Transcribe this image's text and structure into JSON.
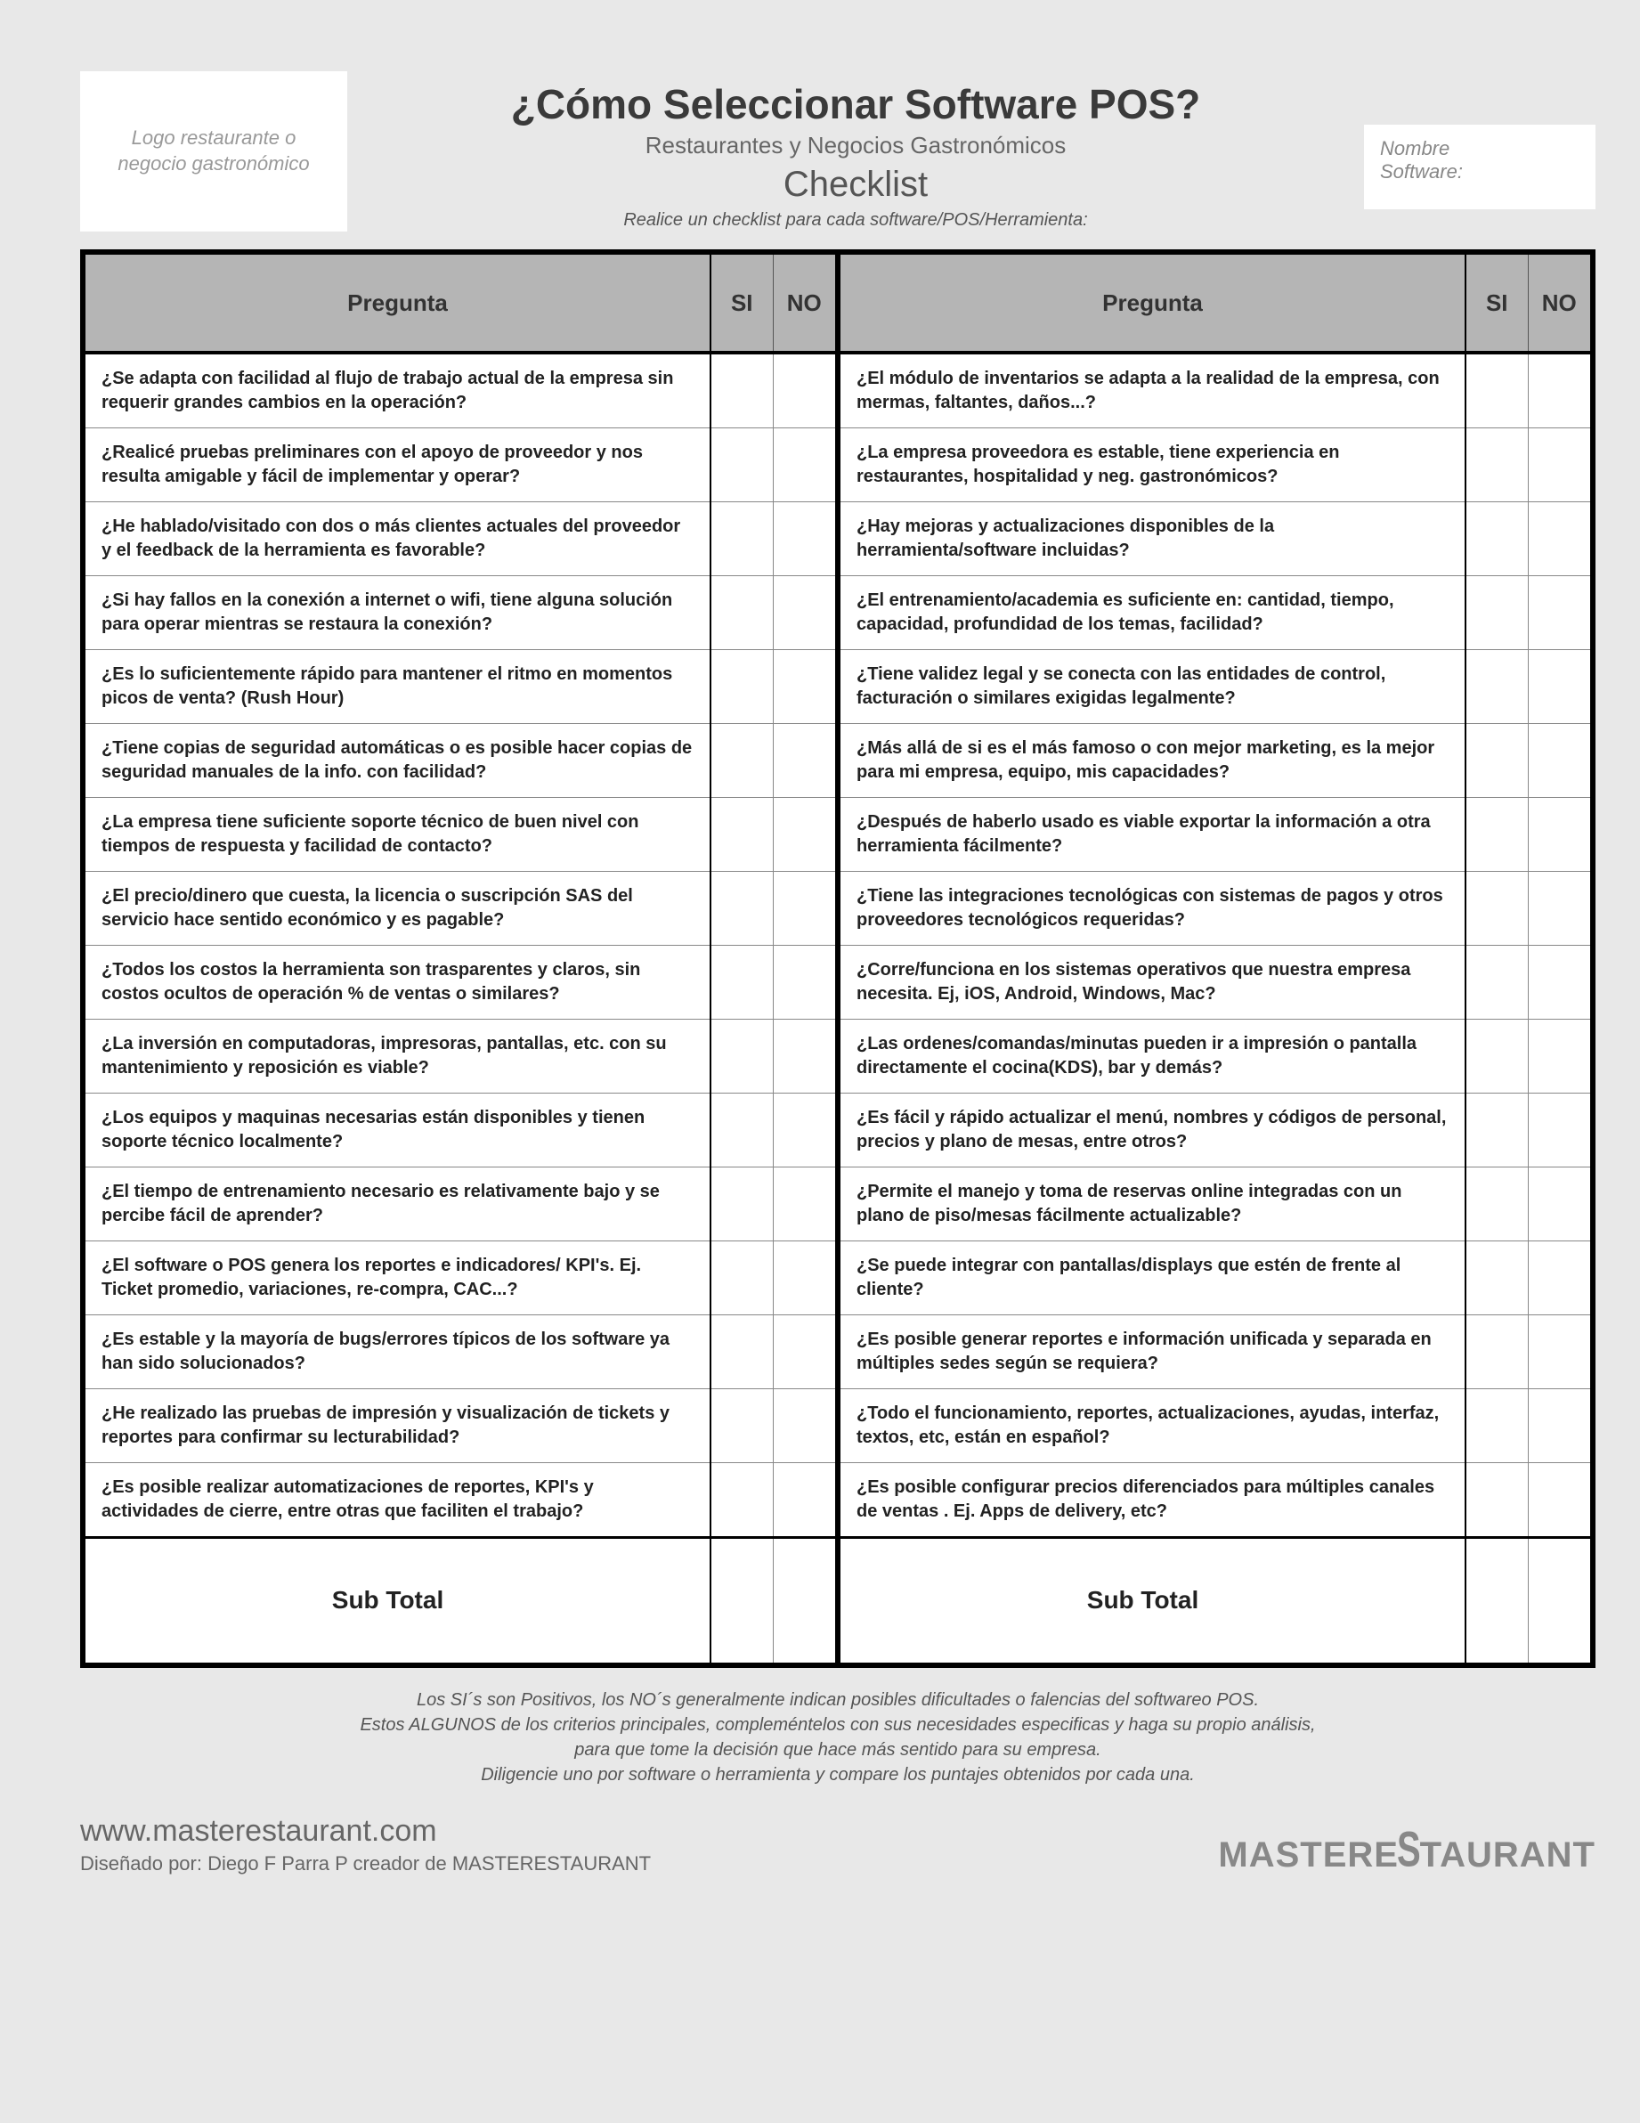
{
  "header": {
    "logo_placeholder": "Logo restaurante o negocio gastronómico",
    "title": "¿Cómo Seleccionar Software POS?",
    "subtitle1": "Restaurantes y Negocios Gastronómicos",
    "subtitle2": "Checklist",
    "subtitle3": "Realice un checklist para cada software/POS/Herramienta:",
    "name_label1": "Nombre",
    "name_label2": "Software:"
  },
  "columns": {
    "q_header": "Pregunta",
    "si_header": "SI",
    "no_header": "NO",
    "subtotal": "Sub Total"
  },
  "left": [
    "¿Se adapta con facilidad al flujo de trabajo actual de la empresa sin requerir grandes cambios en la operación?",
    "¿Realicé pruebas preliminares con el apoyo de proveedor y nos resulta amigable y fácil de implementar y operar?",
    "¿He hablado/visitado con dos o más clientes actuales del proveedor y el feedback de la herramienta es favorable?",
    "¿Si hay fallos en la conexión a internet o wifi, tiene alguna solución para operar mientras se restaura la conexión?",
    "¿Es lo suficientemente rápido para mantener el ritmo en momentos picos de venta? (Rush Hour)",
    "¿Tiene copias de seguridad automáticas o es posible hacer copias de seguridad manuales de la info. con facilidad?",
    "¿La empresa tiene suficiente soporte técnico de buen nivel con tiempos de respuesta y facilidad de contacto?",
    "¿El precio/dinero que cuesta, la licencia o suscripción SAS del servicio hace sentido económico y es pagable?",
    "¿Todos los costos la herramienta son trasparentes y claros, sin costos ocultos de operación % de ventas o similares?",
    "¿La inversión en computadoras, impresoras, pantallas, etc. con su mantenimiento y reposición es viable?",
    "¿Los equipos y maquinas necesarias están disponibles y tienen soporte técnico localmente?",
    "¿El tiempo de entrenamiento necesario es relativamente bajo y se percibe fácil de aprender?",
    "¿El software o POS genera los reportes e indicadores/ KPI's. Ej. Ticket promedio, variaciones, re-compra, CAC...?",
    "¿Es estable y la mayoría de bugs/errores típicos de los software ya han sido solucionados?",
    "¿He realizado las pruebas de impresión y visualización de tickets y reportes para confirmar su lecturabilidad?",
    "¿Es posible realizar automatizaciones de reportes, KPI's y actividades de cierre, entre otras que faciliten el trabajo?"
  ],
  "right": [
    "¿El módulo de inventarios se adapta a la realidad de la empresa, con mermas, faltantes, daños...?",
    "¿La empresa proveedora es estable, tiene experiencia en restaurantes, hospitalidad y neg. gastronómicos?",
    "¿Hay mejoras y actualizaciones disponibles de la herramienta/software incluidas?",
    "¿El entrenamiento/academia es suficiente en: cantidad, tiempo, capacidad, profundidad de los temas, facilidad?",
    "¿Tiene validez legal y se conecta con las entidades de control, facturación o similares exigidas legalmente?",
    "¿Más allá de si es el más famoso o con mejor marketing, es la mejor para mi empresa, equipo, mis capacidades?",
    "¿Después de haberlo usado es viable exportar la información a otra herramienta fácilmente?",
    "¿Tiene las integraciones tecnológicas con sistemas de pagos y otros proveedores tecnológicos requeridas?",
    "¿Corre/funciona en los sistemas operativos que nuestra empresa necesita. Ej, iOS, Android, Windows, Mac?",
    "¿Las ordenes/comandas/minutas pueden ir a impresión o pantalla directamente el cocina(KDS), bar y demás?",
    "¿Es fácil y rápido actualizar el menú, nombres y códigos de personal, precios y plano de mesas, entre otros?",
    "¿Permite el manejo y toma de reservas online integradas con un plano de piso/mesas fácilmente actualizable?",
    "¿Se puede integrar con pantallas/displays que estén de frente al cliente?",
    "¿Es posible generar reportes e información unificada y separada en múltiples sedes según se requiera?",
    "¿Todo el funcionamiento, reportes, actualizaciones, ayudas, interfaz, textos, etc, están en español?",
    "¿Es posible configurar precios diferenciados para múltiples canales de ventas . Ej. Apps de delivery, etc?"
  ],
  "footnotes": [
    "Los SI´s son Positivos, los NO´s generalmente indican posibles dificultades o falencias del softwareo POS.",
    "Estos ALGUNOS de los criterios principales, compleméntelos con sus necesidades especificas y haga su propio análisis,",
    "para que tome la decisión que hace más sentido para su empresa.",
    "Diligencie uno por software o herramienta y compare los puntajes obtenidos por cada una."
  ],
  "footer": {
    "url": "www.masterestaurant.com",
    "credit": "Diseñado por: Diego F Parra P creador de MASTERESTAURANT",
    "brand_pre": "MASTERE",
    "brand_s": "S",
    "brand_post": "TAURANT"
  }
}
